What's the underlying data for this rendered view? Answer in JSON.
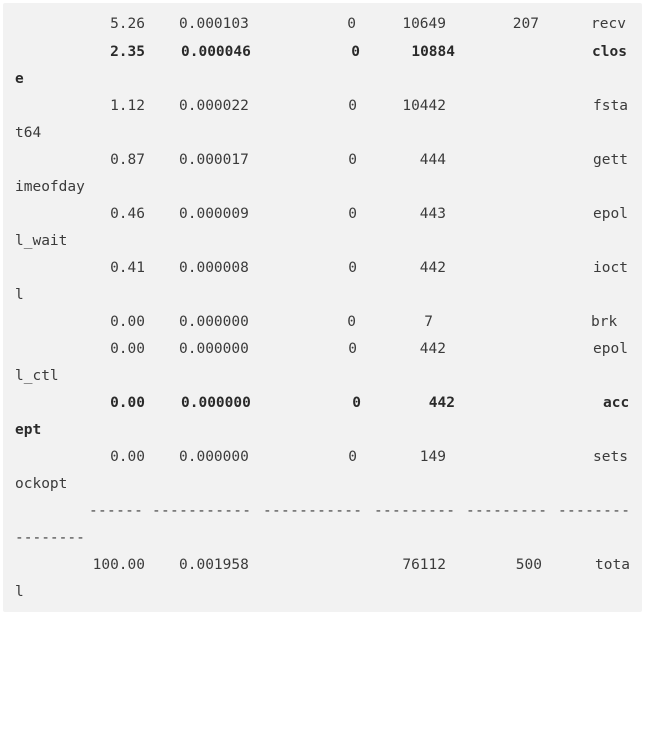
{
  "rows": [
    {
      "percent": "5.26",
      "seconds": "0.000103",
      "errors": "0",
      "calls": "10649",
      "usecs": "207",
      "syscall_a": "recv",
      "syscall_b": "",
      "bold": false
    },
    {
      "percent": "2.35",
      "seconds": "0.000046",
      "errors": "0",
      "calls": "10884",
      "usecs": "",
      "syscall_a": "clos",
      "syscall_b": "e",
      "bold": true
    },
    {
      "percent": "1.12",
      "seconds": "0.000022",
      "errors": "0",
      "calls": "10442",
      "usecs": "",
      "syscall_a": "fsta",
      "syscall_b": "t64",
      "bold": false
    },
    {
      "percent": "0.87",
      "seconds": "0.000017",
      "errors": "0",
      "calls": "444",
      "usecs": "",
      "syscall_a": "gett",
      "syscall_b": "imeofday",
      "bold": false
    },
    {
      "percent": "0.46",
      "seconds": "0.000009",
      "errors": "0",
      "calls": "443",
      "usecs": "",
      "syscall_a": "epol",
      "syscall_b": "l_wait",
      "bold": false
    },
    {
      "percent": "0.41",
      "seconds": "0.000008",
      "errors": "0",
      "calls": "442",
      "usecs": "",
      "syscall_a": "ioct",
      "syscall_b": "l",
      "bold": false
    },
    {
      "percent": "0.00",
      "seconds": "0.000000",
      "errors": "0",
      "calls": "7",
      "usecs": "",
      "syscall_a": "brk",
      "syscall_b": "",
      "bold": false
    },
    {
      "percent": "0.00",
      "seconds": "0.000000",
      "errors": "0",
      "calls": "442",
      "usecs": "",
      "syscall_a": "epol",
      "syscall_b": "l_ctl",
      "bold": false
    },
    {
      "percent": "0.00",
      "seconds": "0.000000",
      "errors": "0",
      "calls": "442",
      "usecs": "",
      "syscall_a": "acc",
      "syscall_b": "ept",
      "bold": true
    },
    {
      "percent": "0.00",
      "seconds": "0.000000",
      "errors": "0",
      "calls": "149",
      "usecs": "",
      "syscall_a": "sets",
      "syscall_b": "ockopt",
      "bold": false
    }
  ],
  "separator": {
    "segments": [
      "------",
      "-----------",
      "-----------",
      "---------",
      "---------",
      "--------"
    ],
    "wrap": "--------"
  },
  "total": {
    "percent": "100.00",
    "seconds": "0.001958",
    "errors": "",
    "calls": "76112",
    "usecs": "500",
    "syscall_a": "tota",
    "syscall_b": "l"
  }
}
